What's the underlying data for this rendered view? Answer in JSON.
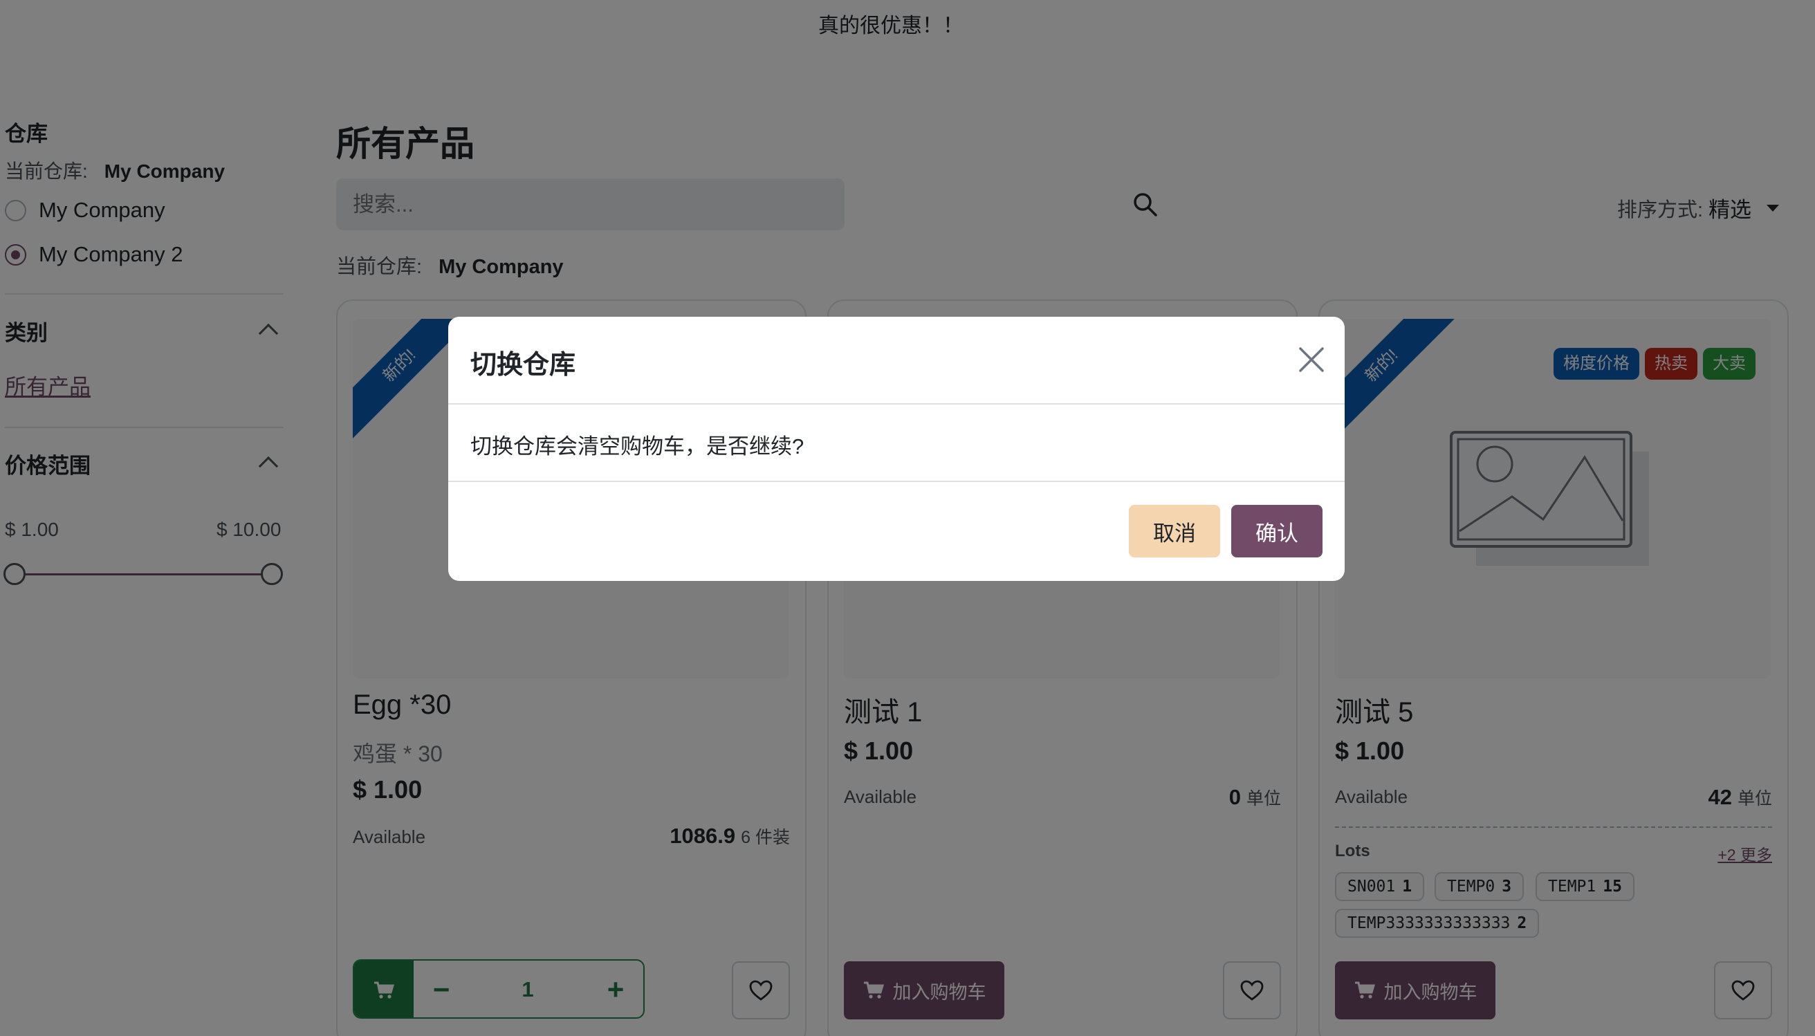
{
  "announcement": "真的很优惠！！",
  "sidebar": {
    "warehouse_title": "仓库",
    "current_label": "当前仓库:",
    "current_value": "My Company",
    "options": [
      {
        "label": "My Company",
        "selected": false
      },
      {
        "label": "My Company 2",
        "selected": true
      }
    ],
    "category_title": "类别",
    "category_link": "所有产品",
    "price_title": "价格范围",
    "price_min": "$ 1.00",
    "price_max": "$ 10.00"
  },
  "main": {
    "title": "所有产品",
    "search_placeholder": "搜索...",
    "current_label": "当前仓库:",
    "current_value": "My Company",
    "sort_label": "排序方式:",
    "sort_value": "精选"
  },
  "products": [
    {
      "ribbon": "新的!",
      "name": "Egg *30",
      "subtitle": "鸡蛋 * 30",
      "price": "$ 1.00",
      "available_label": "Available",
      "qty": "1086.9",
      "unit": "6 件装",
      "stepper_value": "1"
    },
    {
      "name": "测试 1",
      "price": "$ 1.00",
      "available_label": "Available",
      "qty": "0",
      "unit": "单位",
      "add_to_cart": "加入购物车"
    },
    {
      "ribbon": "新的!",
      "badges": [
        {
          "label": "梯度价格",
          "color": "#0b5eb5"
        },
        {
          "label": "热卖",
          "color": "#c3261c"
        },
        {
          "label": "大卖",
          "color": "#2a9d3f"
        }
      ],
      "name": "测试 5",
      "price": "$ 1.00",
      "available_label": "Available",
      "qty": "42",
      "unit": "单位",
      "lots_label": "Lots",
      "lots_more": "+2 更多",
      "lots": [
        {
          "code": "SN001",
          "qty": "1"
        },
        {
          "code": "TEMP0",
          "qty": "3"
        },
        {
          "code": "TEMP1",
          "qty": "15"
        },
        {
          "code": "TEMP3333333333333",
          "qty": "2"
        }
      ],
      "add_to_cart": "加入购物车"
    }
  ],
  "modal": {
    "title": "切换仓库",
    "body": "切换仓库会清空购物车，是否继续?",
    "cancel": "取消",
    "confirm": "确认"
  },
  "colors": {
    "brand": "#714b67",
    "ribbon": "#0b5eb5",
    "stepper_green": "#1c7a42",
    "cancel_bg": "#f5d5b0"
  }
}
